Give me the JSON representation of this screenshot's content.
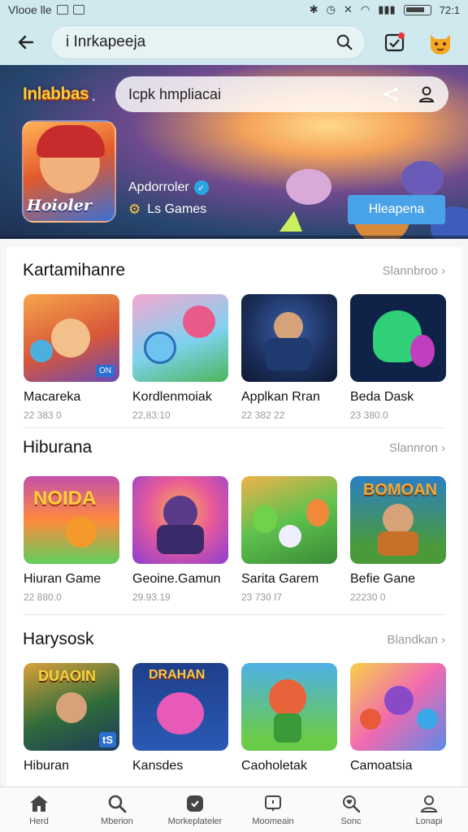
{
  "status_bar": {
    "carrier": "Vlooe lle",
    "time": "72:1"
  },
  "header": {
    "search_text": "i Inrkapeeja"
  },
  "hero": {
    "logo": "Inlabbas",
    "search_text": "Icpk hmpliacai",
    "app_icon_label": "Hoioler",
    "developer": "Apdorroler",
    "subtitle": "Ls Games",
    "button": "Hleapena"
  },
  "sections": [
    {
      "title": "Kartamihanre",
      "more": "Slannbroo",
      "apps": [
        {
          "name": "Macareka",
          "meta": "22 383 0",
          "badge": "ON",
          "colors": [
            "#f7a54a",
            "#d8573a",
            "#6b4bb5"
          ]
        },
        {
          "name": "Kordlenmoiak",
          "meta": "22,83:10",
          "badge": "",
          "colors": [
            "#f6a7d0",
            "#7fd2f0",
            "#4bb55a"
          ]
        },
        {
          "name": "Applkan Rran",
          "meta": "22 382 22",
          "badge": "",
          "colors": [
            "#1b2e5a",
            "#3a5fa8",
            "#0e1730"
          ]
        },
        {
          "name": "Beda Dask",
          "meta": "23 380.0",
          "badge": "",
          "colors": [
            "#0e2347",
            "#2fd078",
            "#c23dbf"
          ]
        }
      ]
    },
    {
      "title": "Hiburana",
      "more": "Slannron",
      "apps": [
        {
          "name": "Hiuran Game",
          "meta": "22 880.0",
          "badge": "",
          "colors": [
            "#ff8a3d",
            "#c44fa8",
            "#5fcf5a"
          ]
        },
        {
          "name": "Geoine.Gamun",
          "meta": "29.93.19",
          "badge": "",
          "colors": [
            "#8a3fd1",
            "#e85a9a",
            "#f7b24a"
          ]
        },
        {
          "name": "Sarita Garem",
          "meta": "23 730 I7",
          "badge": "",
          "colors": [
            "#5ec24e",
            "#3a8a36",
            "#f0b24a"
          ]
        },
        {
          "name": "Befie Gane",
          "meta": "22230 0",
          "badge": "",
          "colors": [
            "#2a7fc5",
            "#f0a83a",
            "#4a9a3a"
          ]
        }
      ]
    },
    {
      "title": "Harysosk",
      "more": "Blandkan",
      "apps": [
        {
          "name": "Hiburan",
          "meta": "",
          "badge": "tS",
          "colors": [
            "#2e6b3a",
            "#d8a13a",
            "#1f3b5a"
          ]
        },
        {
          "name": "Kansdes",
          "meta": "",
          "badge": "",
          "colors": [
            "#1e3f8a",
            "#e85ab8",
            "#f7c84a"
          ]
        },
        {
          "name": "Caoholetak",
          "meta": "",
          "badge": "",
          "colors": [
            "#4fb0e8",
            "#6acb4a",
            "#e8633a"
          ]
        },
        {
          "name": "Camoatsia",
          "meta": "",
          "badge": "",
          "colors": [
            "#f06ab0",
            "#f8d04a",
            "#5a8ae8"
          ]
        }
      ]
    }
  ],
  "nav": [
    {
      "label": "Herd",
      "icon": "home-icon"
    },
    {
      "label": "Mberion",
      "icon": "search-icon"
    },
    {
      "label": "Morkeplateler",
      "icon": "market-icon"
    },
    {
      "label": "Moomeain",
      "icon": "message-icon"
    },
    {
      "label": "Sonc",
      "icon": "search-heart-icon"
    },
    {
      "label": "Lonapi",
      "icon": "profile-icon"
    }
  ]
}
